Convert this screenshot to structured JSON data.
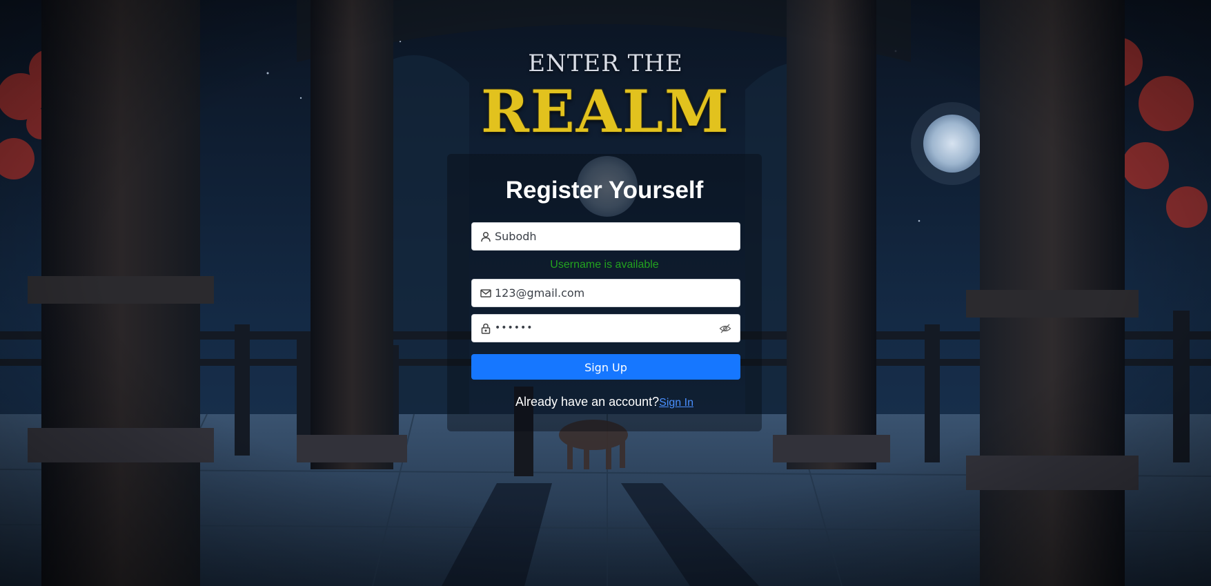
{
  "logo": {
    "line1": "ENTER THE",
    "line2": "REALM"
  },
  "form": {
    "title": "Register Yourself",
    "username": {
      "value": "Subodh",
      "icon": "user-icon"
    },
    "username_status": "Username is available",
    "email": {
      "value": "123@gmail.com",
      "icon": "mail-icon"
    },
    "password": {
      "value": "••••••",
      "icon": "lock-icon",
      "toggle_icon": "eye-off-icon"
    },
    "submit_label": "Sign Up",
    "footer_text": "Already have an account?",
    "signin_link": "Sign In"
  },
  "colors": {
    "accent_button": "#1677ff",
    "status_ok": "#23a31f",
    "link": "#4a90ff",
    "logo_gold": "#e2c21e"
  }
}
